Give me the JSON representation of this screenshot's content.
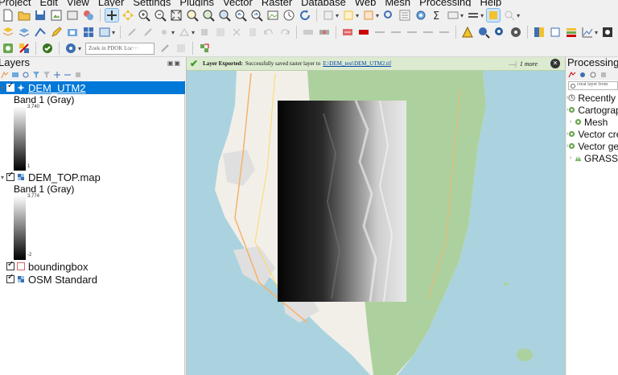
{
  "menu": [
    "Project",
    "Edit",
    "View",
    "Layer",
    "Settings",
    "Plugins",
    "Vector",
    "Raster",
    "Database",
    "Web",
    "Mesh",
    "Processing",
    "Help"
  ],
  "toolbar": {
    "locator_placeholder": "Zoek in PDOK Loc···"
  },
  "layers_panel": {
    "title": "Layers",
    "layers": [
      {
        "name": "DEM_UTM2",
        "selected": true,
        "checked": true,
        "band": "Band 1 (Gray)",
        "max": "3,740",
        "min": "1"
      },
      {
        "name": "DEM_TOP.map",
        "selected": false,
        "checked": true,
        "band": "Band 1 (Gray)",
        "max": "3,774",
        "min": "-2"
      },
      {
        "name": "boundingbox",
        "selected": false,
        "checked": true
      },
      {
        "name": "OSM Standard",
        "selected": false,
        "checked": true
      }
    ]
  },
  "message_bar": {
    "title": "Layer Exported:",
    "text": "Successfully saved raster layer to",
    "link": "E:\\DEM_test\\DEM_UTM2.tif",
    "more": "1 more"
  },
  "processing_panel": {
    "title": "Processing Toolbox",
    "search_placeholder": "creat layer from",
    "items": [
      "Recently used",
      "Cartography",
      "Mesh",
      "Vector creation",
      "Vector general",
      "GRASS"
    ]
  },
  "colors": {
    "selection": "#0078d7",
    "message_bg": "#dcebd0",
    "land": "#f2efe9",
    "water": "#aad3df",
    "forest": "#add19e",
    "urban": "#e0dfdf"
  }
}
